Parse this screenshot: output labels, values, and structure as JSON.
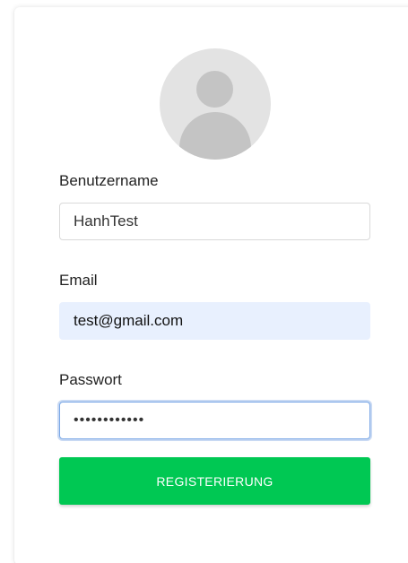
{
  "avatar": {
    "icon": "user-placeholder-icon"
  },
  "form": {
    "username": {
      "label": "Benutzername",
      "value": "HanhTest"
    },
    "email": {
      "label": "Email",
      "value": "test@gmail.com"
    },
    "password": {
      "label": "Passwort",
      "value": "••••••••••••"
    }
  },
  "submit": {
    "label": "REGISTERIERUNG"
  },
  "colors": {
    "primary_button": "#00c853",
    "autofill_bg": "#e8f0fe",
    "focus_ring": "#7aa7e6"
  }
}
